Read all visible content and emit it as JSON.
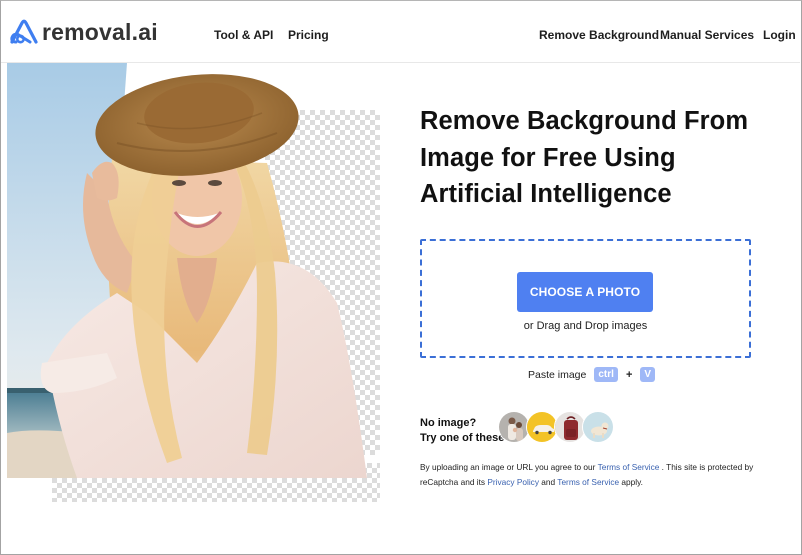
{
  "brand": {
    "name": "removal.ai",
    "accent_color": "#3f7ef0",
    "logo_icon": "removal-ai-logo-icon"
  },
  "nav": {
    "left": [
      {
        "label": "Tool & API"
      },
      {
        "label": "Pricing"
      }
    ],
    "right": [
      {
        "label": "Remove Background"
      },
      {
        "label": "Manual Services"
      },
      {
        "label": "Login"
      }
    ]
  },
  "hero": {
    "image_description": "Smiling woman with long blonde hair and straw hat on beach, background partially removed showing transparency checkerboard",
    "headline": [
      "Remove Background From",
      "Image for Free Using",
      "Artificial Intelligence"
    ]
  },
  "upload": {
    "button_label": "CHOOSE A PHOTO",
    "button_color": "#4f80f1",
    "drag_text": "or Drag and Drop images",
    "border_color": "#3b6fd6",
    "paste_label": "Paste image",
    "key_ctrl": "ctrl",
    "key_plus": "+",
    "key_v": "V"
  },
  "samples": {
    "label_line1": "No image?",
    "label_line2": "Try one of these",
    "items": [
      {
        "name": "family",
        "icon": "family-photo-icon"
      },
      {
        "name": "car",
        "icon": "car-photo-icon"
      },
      {
        "name": "backpack",
        "icon": "backpack-photo-icon"
      },
      {
        "name": "dog",
        "icon": "dog-photo-icon"
      }
    ]
  },
  "legal": {
    "part1": "By uploading an image or URL you agree to our ",
    "terms_link_1": "Terms of Service",
    "part2": " . This site is protected by reCaptcha and its ",
    "privacy_link": "Privacy Policy",
    "part3": " and ",
    "terms_link_2": "Terms of Service",
    "part4": " apply."
  }
}
